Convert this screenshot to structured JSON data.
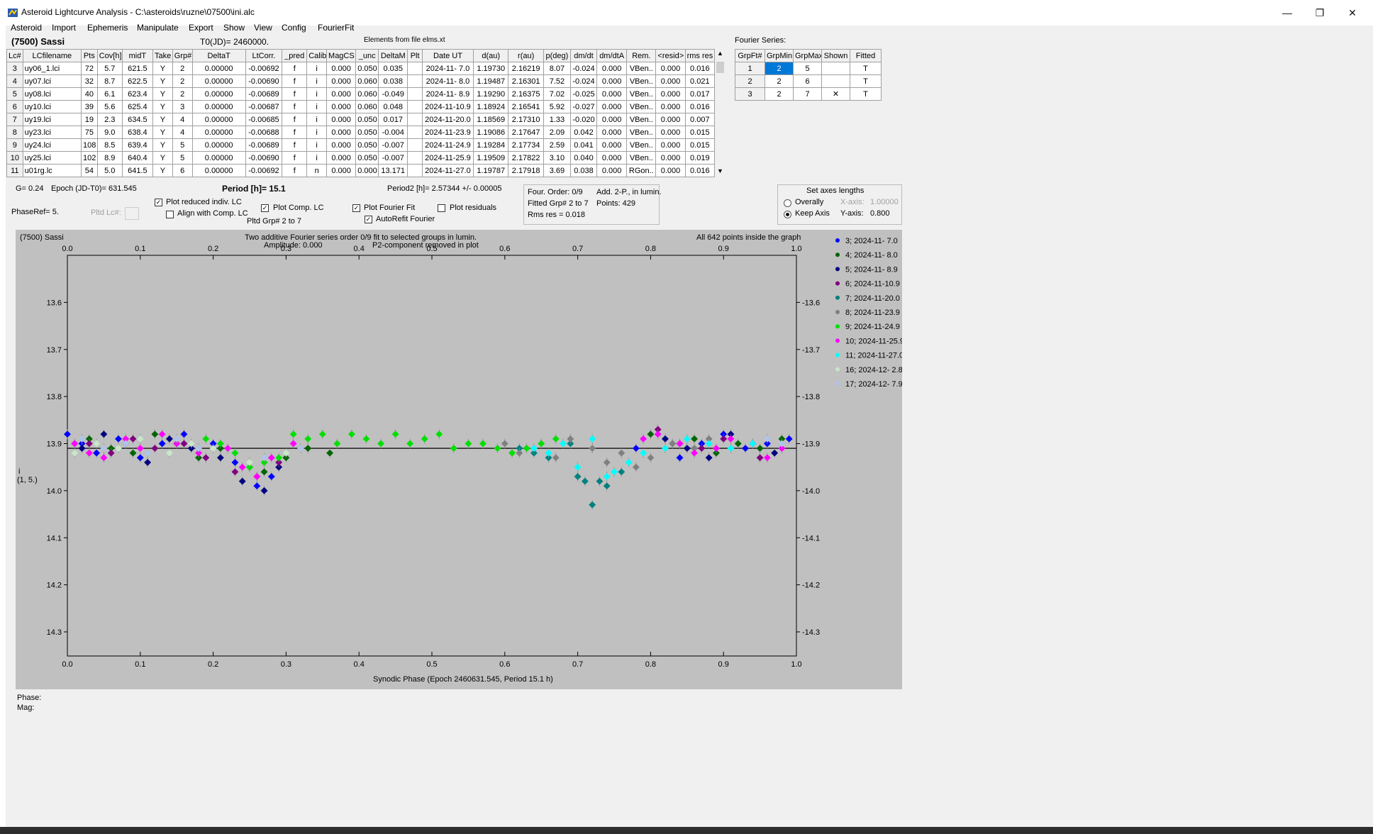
{
  "window": {
    "title": "Asteroid Lightcurve Analysis - C:\\asteroids\\ruzne\\07500\\ini.alc",
    "minimize": "—",
    "restore": "❐",
    "close": "✕"
  },
  "menu": [
    "Asteroid",
    "Import",
    "Ephemeris",
    "Manipulate",
    "Export",
    "Show",
    "View",
    "Config",
    "FourierFit"
  ],
  "header": {
    "asteroid": "(7500) Sassi",
    "t0": "T0(JD)= 2460000.",
    "elements": "Elements from file elms.xt",
    "fourier_series": "Fourier Series:"
  },
  "lc_table": {
    "columns": [
      "Lc#",
      "LCfilename",
      "Pts",
      "Cov[h]",
      "midT",
      "Take",
      "Grp#",
      "DeltaT",
      "LtCorr.",
      "_pred",
      "Calib",
      "MagCS",
      "_unc",
      "DeltaM",
      "Plt",
      "Date UT",
      "d(au)",
      "r(au)",
      "p(deg)",
      "dm/dt",
      "dm/dtA",
      "Rem.",
      "<resid>",
      "rms res"
    ],
    "rows": [
      [
        "3",
        "uy06_1.lci",
        "72",
        "5.7",
        "621.5",
        "Y",
        "2",
        "0.00000",
        "-0.00692",
        "f",
        "i",
        "0.000",
        "0.050",
        "0.035",
        "",
        "2024-11- 7.0",
        "1.19730",
        "2.16219",
        "8.07",
        "-0.024",
        "0.000",
        "VBen..",
        "0.000",
        "0.016"
      ],
      [
        "4",
        "uy07.lci",
        "32",
        "8.7",
        "622.5",
        "Y",
        "2",
        "0.00000",
        "-0.00690",
        "f",
        "i",
        "0.000",
        "0.060",
        "0.038",
        "",
        "2024-11- 8.0",
        "1.19487",
        "2.16301",
        "7.52",
        "-0.024",
        "0.000",
        "VBen..",
        "0.000",
        "0.021"
      ],
      [
        "5",
        "uy08.lci",
        "40",
        "6.1",
        "623.4",
        "Y",
        "2",
        "0.00000",
        "-0.00689",
        "f",
        "i",
        "0.000",
        "0.060",
        "-0.049",
        "",
        "2024-11- 8.9",
        "1.19290",
        "2.16375",
        "7.02",
        "-0.025",
        "0.000",
        "VBen..",
        "0.000",
        "0.017"
      ],
      [
        "6",
        "uy10.lci",
        "39",
        "5.6",
        "625.4",
        "Y",
        "3",
        "0.00000",
        "-0.00687",
        "f",
        "i",
        "0.000",
        "0.060",
        "0.048",
        "",
        "2024-11-10.9",
        "1.18924",
        "2.16541",
        "5.92",
        "-0.027",
        "0.000",
        "VBen..",
        "0.000",
        "0.016"
      ],
      [
        "7",
        "uy19.lci",
        "19",
        "2.3",
        "634.5",
        "Y",
        "4",
        "0.00000",
        "-0.00685",
        "f",
        "i",
        "0.000",
        "0.050",
        "0.017",
        "",
        "2024-11-20.0",
        "1.18569",
        "2.17310",
        "1.33",
        "-0.020",
        "0.000",
        "VBen..",
        "0.000",
        "0.007"
      ],
      [
        "8",
        "uy23.lci",
        "75",
        "9.0",
        "638.4",
        "Y",
        "4",
        "0.00000",
        "-0.00688",
        "f",
        "i",
        "0.000",
        "0.050",
        "-0.004",
        "",
        "2024-11-23.9",
        "1.19086",
        "2.17647",
        "2.09",
        "0.042",
        "0.000",
        "VBen..",
        "0.000",
        "0.015"
      ],
      [
        "9",
        "uy24.lci",
        "108",
        "8.5",
        "639.4",
        "Y",
        "5",
        "0.00000",
        "-0.00689",
        "f",
        "i",
        "0.000",
        "0.050",
        "-0.007",
        "",
        "2024-11-24.9",
        "1.19284",
        "2.17734",
        "2.59",
        "0.041",
        "0.000",
        "VBen..",
        "0.000",
        "0.015"
      ],
      [
        "10",
        "uy25.lci",
        "102",
        "8.9",
        "640.4",
        "Y",
        "5",
        "0.00000",
        "-0.00690",
        "f",
        "i",
        "0.000",
        "0.050",
        "-0.007",
        "",
        "2024-11-25.9",
        "1.19509",
        "2.17822",
        "3.10",
        "0.040",
        "0.000",
        "VBen..",
        "0.000",
        "0.019"
      ],
      [
        "11",
        "u01rg.lc",
        "54",
        "5.0",
        "641.5",
        "Y",
        "6",
        "0.00000",
        "-0.00692",
        "f",
        "n",
        "0.000",
        "0.000",
        "13.171",
        "",
        "2024-11-27.0",
        "1.19787",
        "2.17918",
        "3.69",
        "0.038",
        "0.000",
        "RGon..",
        "0.000",
        "0.016"
      ]
    ]
  },
  "fourier_table": {
    "columns": [
      "GrpFt#",
      "GrpMin",
      "GrpMax",
      "Shown",
      "Fitted"
    ],
    "rows": [
      [
        "1",
        "2",
        "5",
        "",
        "T"
      ],
      [
        "2",
        "2",
        "6",
        "",
        "T"
      ],
      [
        "3",
        "2",
        "7",
        "✕",
        "T"
      ]
    ]
  },
  "controls": {
    "g": "G= 0.24",
    "epoch": "Epoch (JD-T0)= 631.545",
    "period": "Period [h]= 15.1",
    "period2": "Period2 [h]= 2.57344 +/- 0.00005",
    "phaseref": "PhaseRef= 5.",
    "pltd_lc": "Pltd Lc#:",
    "plot_reduced": "Plot reduced indiv. LC",
    "align_comp": "Align with Comp. LC",
    "plot_comp": "Plot Comp. LC",
    "pltd_grp": "Pltd Grp#  2   to   7",
    "plot_fourier": "Plot Fourier Fit",
    "autorefit": "AutoRefit Fourier",
    "plot_residuals": "Plot residuals",
    "check": "✓"
  },
  "info": {
    "four_order": "Four. Order:  0/9",
    "add": "Add. 2-P., in lumin.",
    "fitted": "Fitted Grp# 2 to 7",
    "points": "Points: 429",
    "rms": "Rms res      = 0.018"
  },
  "axes_box": {
    "title": "Set axes lengths",
    "overally": "Overally",
    "keep": "Keep Axis",
    "xaxis": "X-axis:",
    "xval": "1.00000",
    "yaxis": "Y-axis:",
    "yval": "0.800"
  },
  "plot": {
    "name": "(7500) Sassi",
    "desc1": "Two additive Fourier series order 0/9 fit to selected groups in lumin.",
    "desc2": "Amplitude: 0.000",
    "desc3": "P2-component removed in plot",
    "inside": "All 642 points inside the graph",
    "ylabel1": "i",
    "ylabel2": "(1, 5.)",
    "xlabel": "Synodic Phase (Epoch 2460631.545, Period 15.1 h)"
  },
  "footer": {
    "phase": "Phase:",
    "mag": "Mag:"
  },
  "chart_data": {
    "type": "scatter",
    "xlabel": "Synodic Phase (Epoch 2460631.545, Period 15.1 h)",
    "ylabel": "i (1, 5.)",
    "xlim": [
      0.0,
      1.0
    ],
    "ylim": [
      13.55,
      14.35
    ],
    "y_inverted": true,
    "x_ticks": [
      "0.0",
      "0.1",
      "0.2",
      "0.3",
      "0.4",
      "0.5",
      "0.6",
      "0.7",
      "0.8",
      "0.9",
      "1.0"
    ],
    "y_ticks": [
      "13.6",
      "13.7",
      "13.8",
      "13.9",
      "14.0",
      "14.1",
      "14.2",
      "14.3"
    ],
    "fit_line_y": 13.91,
    "legend_position": "right",
    "series": [
      {
        "name": "3; 2024-11- 7.0",
        "color": "#0000ff",
        "x": [
          0.0,
          0.02,
          0.04,
          0.07,
          0.1,
          0.13,
          0.16,
          0.2,
          0.23,
          0.26,
          0.28,
          0.78,
          0.84,
          0.87,
          0.9,
          0.93,
          0.96,
          0.99
        ],
        "y": [
          13.88,
          13.9,
          13.92,
          13.89,
          13.93,
          13.9,
          13.88,
          13.9,
          13.94,
          13.99,
          13.97,
          13.91,
          13.93,
          13.9,
          13.88,
          13.91,
          13.9,
          13.89
        ]
      },
      {
        "name": "4; 2024-11- 8.0",
        "color": "#006400",
        "x": [
          0.01,
          0.03,
          0.06,
          0.09,
          0.12,
          0.15,
          0.18,
          0.21,
          0.25,
          0.27,
          0.3,
          0.33,
          0.36,
          0.8,
          0.83,
          0.86,
          0.89,
          0.92,
          0.95,
          0.98
        ],
        "y": [
          13.9,
          13.89,
          13.91,
          13.92,
          13.88,
          13.9,
          13.93,
          13.91,
          13.95,
          13.96,
          13.93,
          13.91,
          13.92,
          13.88,
          13.9,
          13.89,
          13.92,
          13.9,
          13.91,
          13.89
        ]
      },
      {
        "name": "5; 2024-11- 8.9",
        "color": "#000080",
        "x": [
          0.02,
          0.05,
          0.08,
          0.11,
          0.14,
          0.17,
          0.21,
          0.24,
          0.27,
          0.29,
          0.82,
          0.85,
          0.88,
          0.91,
          0.94,
          0.97
        ],
        "y": [
          13.91,
          13.88,
          13.9,
          13.94,
          13.89,
          13.91,
          13.93,
          13.98,
          14.0,
          13.95,
          13.89,
          13.91,
          13.93,
          13.88,
          13.9,
          13.92
        ]
      },
      {
        "name": "6; 2024-11-10.9",
        "color": "#800080",
        "x": [
          0.03,
          0.06,
          0.09,
          0.12,
          0.16,
          0.19,
          0.23,
          0.26,
          0.29,
          0.81,
          0.84,
          0.87,
          0.9,
          0.95
        ],
        "y": [
          13.9,
          13.92,
          13.89,
          13.91,
          13.9,
          13.93,
          13.96,
          13.97,
          13.94,
          13.87,
          13.9,
          13.91,
          13.89,
          13.93
        ]
      },
      {
        "name": "7; 2024-11-20.0",
        "color": "#008080",
        "x": [
          0.62,
          0.64,
          0.66,
          0.69,
          0.7,
          0.71,
          0.72,
          0.73,
          0.74,
          0.76
        ],
        "y": [
          13.91,
          13.92,
          13.93,
          13.9,
          13.97,
          13.98,
          14.03,
          13.98,
          13.99,
          13.96
        ]
      },
      {
        "name": "8; 2024-11-23.9",
        "color": "#808080",
        "x": [
          0.6,
          0.62,
          0.63,
          0.65,
          0.67,
          0.69,
          0.72,
          0.74,
          0.76,
          0.78,
          0.8,
          0.83,
          0.86,
          0.88
        ],
        "y": [
          13.9,
          13.92,
          13.91,
          13.9,
          13.93,
          13.89,
          13.91,
          13.94,
          13.92,
          13.95,
          13.93,
          13.9,
          13.91,
          13.89
        ]
      },
      {
        "name": "9; 2024-11-24.9",
        "color": "#00e000",
        "x": [
          0.19,
          0.21,
          0.23,
          0.25,
          0.27,
          0.29,
          0.31,
          0.33,
          0.35,
          0.37,
          0.39,
          0.41,
          0.43,
          0.45,
          0.47,
          0.49,
          0.51,
          0.53,
          0.55,
          0.57,
          0.59,
          0.61,
          0.63,
          0.65,
          0.67
        ],
        "y": [
          13.89,
          13.9,
          13.92,
          13.95,
          13.94,
          13.93,
          13.88,
          13.89,
          13.88,
          13.9,
          13.88,
          13.89,
          13.9,
          13.88,
          13.9,
          13.89,
          13.88,
          13.91,
          13.9,
          13.9,
          13.91,
          13.92,
          13.91,
          13.9,
          13.89
        ]
      },
      {
        "name": "10; 2024-11-25.9",
        "color": "#ff00ff",
        "x": [
          0.01,
          0.03,
          0.05,
          0.08,
          0.1,
          0.13,
          0.15,
          0.18,
          0.22,
          0.24,
          0.26,
          0.28,
          0.31,
          0.79,
          0.81,
          0.84,
          0.86,
          0.89,
          0.91,
          0.94,
          0.96,
          0.98
        ],
        "y": [
          13.9,
          13.92,
          13.93,
          13.89,
          13.91,
          13.88,
          13.9,
          13.92,
          13.91,
          13.95,
          13.97,
          13.93,
          13.9,
          13.89,
          13.88,
          13.9,
          13.92,
          13.91,
          13.89,
          13.9,
          13.93,
          13.91
        ]
      },
      {
        "name": "11; 2024-11-27.0",
        "color": "#00ffff",
        "x": [
          0.64,
          0.66,
          0.68,
          0.7,
          0.72,
          0.74,
          0.75,
          0.77,
          0.79,
          0.82,
          0.85,
          0.88,
          0.91,
          0.94
        ],
        "y": [
          13.91,
          13.92,
          13.9,
          13.95,
          13.89,
          13.97,
          13.96,
          13.94,
          13.92,
          13.91,
          13.89,
          13.9,
          13.91,
          13.9
        ]
      },
      {
        "name": "16; 2024-12- 2.8",
        "color": "#c8e6c8",
        "x": [
          0.01,
          0.04,
          0.07,
          0.1,
          0.14,
          0.17,
          0.2,
          0.25,
          0.3
        ],
        "y": [
          13.92,
          13.9,
          13.91,
          13.89,
          13.92,
          13.9,
          13.91,
          13.94,
          13.92
        ]
      },
      {
        "name": "17; 2024-12- 7.9",
        "color": "#b0c4e8",
        "x": [
          0.02,
          0.05,
          0.08,
          0.11,
          0.15,
          0.18,
          0.27,
          0.32,
          0.96,
          0.98
        ],
        "y": [
          13.89,
          13.91,
          13.9,
          13.92,
          13.89,
          13.91,
          13.93,
          13.91,
          13.89,
          13.9
        ]
      }
    ]
  }
}
